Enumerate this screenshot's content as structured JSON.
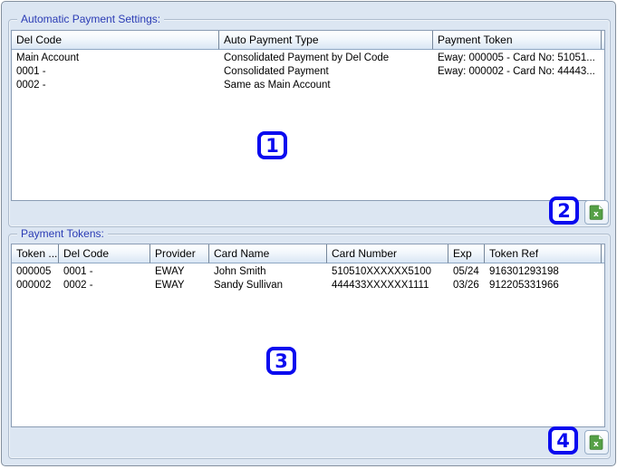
{
  "theme": {
    "window_background": "#dce6f2",
    "group_title_blue": "#2b3cb5",
    "annotation_blue": "#0a0aef",
    "excel_icon_green": "#55a046"
  },
  "panel1": {
    "title": "Automatic Payment Settings:",
    "columns": [
      "Del Code",
      "Auto Payment Type",
      "Payment Token"
    ],
    "rows": [
      [
        "Main Account",
        "Consolidated Payment by Del Code",
        "Eway: 000005 - Card No: 51051..."
      ],
      [
        "0001 -",
        "Consolidated Payment",
        "Eway: 000002 - Card No: 44443..."
      ],
      [
        "0002 -",
        "Same as Main Account",
        ""
      ]
    ]
  },
  "panel2": {
    "title": "Payment Tokens:",
    "columns": [
      "Token ...",
      "Del Code",
      "Provider",
      "Card Name",
      "Card Number",
      "Exp",
      "Token Ref"
    ],
    "rows": [
      [
        "000005",
        "0001 -",
        "EWAY",
        "John Smith",
        "510510XXXXXX5100",
        "05/24",
        "916301293198"
      ],
      [
        "000002",
        "0002 -",
        "EWAY",
        "Sandy Sullivan",
        "444433XXXXXX1111",
        "03/26",
        "912205331966"
      ]
    ]
  },
  "annotations": {
    "n1": "1",
    "n2": "2",
    "n3": "3",
    "n4": "4"
  }
}
